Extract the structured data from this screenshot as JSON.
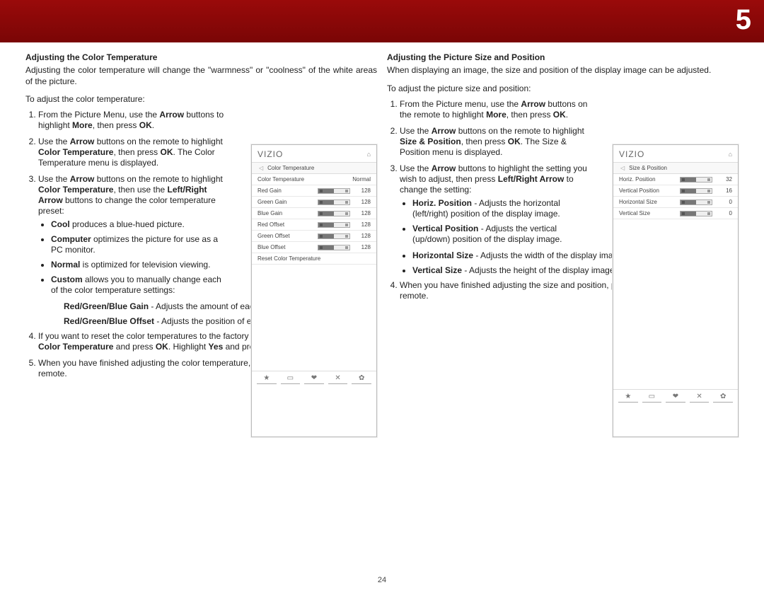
{
  "chapter_number": "5",
  "page_number": "24",
  "left": {
    "heading": "Adjusting the Color Temperature",
    "intro": "Adjusting the color temperature will change the \"warmness\" or \"coolness\" of the white areas of the picture.",
    "lead": "To adjust the color temperature:",
    "step1": "From the Picture Menu, use the <span class=\"b\">Arrow</span> buttons to highlight <span class=\"b\">More</span>, then press <span class=\"b\">OK</span>.",
    "step2": "Use the <span class=\"b\">Arrow</span> buttons on the remote to highlight <span class=\"b\">Color Temperature</span>, then press <span class=\"b\">OK</span>. The Color Temperature menu is displayed.",
    "step3": "Use the <span class=\"b\">Arrow</span> buttons on the remote to highlight <span class=\"b\">Color Temperature</span>, then use the <span class=\"b\">Left/Right Arrow</span> buttons to change the color temperature preset:",
    "s3a": "<span class=\"b\">Cool</span> produces a blue-hued picture.",
    "s3b": "<span class=\"b\">Computer</span> optimizes the picture for use as a PC monitor.",
    "s3c": "<span class=\"b\">Normal</span> is optimized for television viewing.",
    "s3d": "<span class=\"b\">Custom</span> allows you to manually change each of the color temperature settings:",
    "s3d1": "<span class=\"b\">Red/Green/Blue Gain</span> - Adjusts the amount of each color in the display.",
    "s3d2": "<span class=\"b\">Red/Green/Blue Offset</span> - Adjusts the position of each color in the display.",
    "step4": "If you want to reset the color temperatures to the factory default settings, highlight <span class=\"b\">Reset Color Temperature</span> and press <span class=\"b\">OK</span>. Highlight  <span class=\"b\">Yes</span> and press <span class=\"b\">OK</span>.",
    "step5": "When you have finished adjusting the color temperature, press the <span class=\"b\">EXIT</span> button on the remote."
  },
  "right": {
    "heading": "Adjusting the Picture Size and Position",
    "intro": "When displaying an image, the size and position of the display image can be adjusted.",
    "lead": "To adjust the picture size and position:",
    "step1": "From the Picture menu, use the <span class=\"b\">Arrow</span> buttons on the remote to highlight <span class=\"b\">More</span>, then press <span class=\"b\">OK</span>.",
    "step2": "Use the <span class=\"b\">Arrow</span> buttons on the remote to highlight <span class=\"b\">Size & Position</span>, then press <span class=\"b\">OK</span>. The Size & Position menu is displayed.",
    "step3": "Use the <span class=\"b\">Arrow</span> buttons to highlight the setting you wish to adjust, then press <span class=\"b\">Left/Right Arrow</span> to change the setting:",
    "s3a": "<span class=\"b\">Horiz. Position</span> - Adjusts the horizontal (left/right) position of the display image.",
    "s3b": "<span class=\"b\">Vertical Position</span> - Adjusts the vertical (up/down) position of the display image.",
    "s3c": "<span class=\"b\">Horizontal Size</span> - Adjusts the width of the display image.",
    "s3d": "<span class=\"b\">Vertical Size</span> - Adjusts the height of the display image.",
    "step4": "When you have finished adjusting the size and position, press the <span class=\"b\">EXIT</span> button on the remote."
  },
  "osd_left": {
    "brand": "VIZIO",
    "title": "Color Temperature",
    "rows": [
      {
        "label": "Color Temperature",
        "value": "Normal",
        "slider": false
      },
      {
        "label": "Red Gain",
        "value": "128",
        "slider": true
      },
      {
        "label": "Green Gain",
        "value": "128",
        "slider": true
      },
      {
        "label": "Blue Gain",
        "value": "128",
        "slider": true
      },
      {
        "label": "Red Offset",
        "value": "128",
        "slider": true
      },
      {
        "label": "Green Offset",
        "value": "128",
        "slider": true
      },
      {
        "label": "Blue Offset",
        "value": "128",
        "slider": true
      },
      {
        "label": "Reset Color Temperature",
        "value": "",
        "slider": false
      }
    ]
  },
  "osd_right": {
    "brand": "VIZIO",
    "title": "Size & Position",
    "rows": [
      {
        "label": "Horiz. Position",
        "value": "32",
        "slider": true
      },
      {
        "label": "Vertical Position",
        "value": "16",
        "slider": true
      },
      {
        "label": "Horizontal Size",
        "value": "0",
        "slider": true
      },
      {
        "label": "Vertical Size",
        "value": "0",
        "slider": true
      }
    ]
  },
  "footer_icons": [
    "★",
    "▭",
    "❤",
    "✕",
    "✿"
  ]
}
